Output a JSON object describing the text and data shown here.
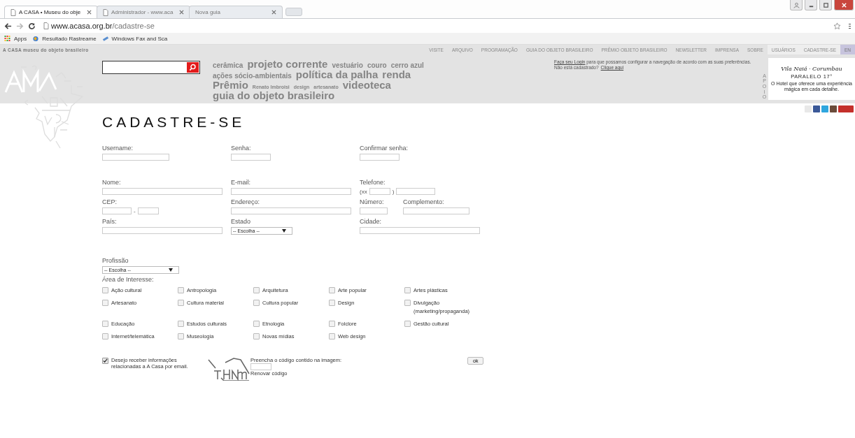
{
  "browser": {
    "tabs": [
      {
        "title": "A CASA • Museu do obje",
        "selected": true
      },
      {
        "title": "Administrador - www.aca",
        "selected": false
      },
      {
        "title": "Nova guia",
        "selected": false
      }
    ],
    "url": {
      "host": "www.acasa.org.br",
      "path": "/cadastre-se"
    },
    "bookmarks": [
      {
        "label": "Apps",
        "kind": "apps"
      },
      {
        "label": "Resultado Rastreame",
        "kind": "globe"
      },
      {
        "label": "Windows Fax and Sca",
        "kind": "fax"
      }
    ]
  },
  "site": {
    "brand": "A CASA museu do objeto brasileiro",
    "nav": [
      {
        "label": "VISITE",
        "kind": "page"
      },
      {
        "label": "ARQUIVO",
        "kind": "page"
      },
      {
        "label": "PROGRAMAÇÃO",
        "kind": "page"
      },
      {
        "label": "GUIA DO OBJETO BRASILEIRO",
        "kind": "page"
      },
      {
        "label": "PRÊMIO OBJETO BRASILEIRO",
        "kind": "page"
      },
      {
        "label": "NEWSLETTER",
        "kind": "page"
      },
      {
        "label": "IMPRENSA",
        "kind": "page"
      },
      {
        "label": "SOBRE",
        "kind": "page"
      },
      {
        "label": "USUÁRIOS",
        "kind": "user"
      },
      {
        "label": "CADASTRE-SE",
        "kind": "user"
      },
      {
        "label": "EN",
        "kind": "lang"
      }
    ],
    "tags": [
      {
        "label": "cerâmica"
      },
      {
        "label": "projeto corrente"
      },
      {
        "label": "vestuário"
      },
      {
        "label": "couro"
      },
      {
        "label": "cerro azul"
      },
      {
        "label": "ações sócio-ambientais"
      },
      {
        "label": "política da palha"
      },
      {
        "label": "renda"
      },
      {
        "label": "Prêmio"
      },
      {
        "label": "Renato Imbroisi"
      },
      {
        "label": "design"
      },
      {
        "label": "artesanato"
      },
      {
        "label": "videoteca"
      },
      {
        "label": "guia do objeto brasileiro"
      }
    ],
    "login": {
      "link": "Faça seu Login",
      "text": "para que possamos configurar a navegação de acordo com as suas preferências.",
      "question": "Não está cadastrado?",
      "signup_link": "Clique aqui"
    },
    "sponsor": {
      "label": "APOIO",
      "name": "Vila Naiá · Corumbau",
      "sub": "PARALELO 17°",
      "text": "O Hotel que oferece uma experiência mágica em cada detalhe."
    },
    "social": [
      {
        "kind": "mail"
      },
      {
        "kind": "facebook"
      },
      {
        "kind": "twitter"
      },
      {
        "kind": "instagram"
      },
      {
        "kind": "youtube"
      }
    ]
  },
  "form": {
    "title": "CADASTRE-SE",
    "rows": [
      [
        {
          "label": "Username:",
          "kind": "text"
        },
        {
          "label": "Senha:",
          "kind": "text"
        },
        {
          "label": "Confirmar senha:",
          "kind": "text"
        }
      ],
      [
        {
          "label": "Nome:",
          "kind": "text"
        },
        {
          "label": "E-mail:",
          "kind": "text"
        },
        {
          "label": "Telefone:",
          "kind": "phone",
          "prefix": "(xx",
          "suffix": ")"
        }
      ],
      [
        {
          "label": "CEP:",
          "kind": "cep",
          "separator": "-"
        },
        {
          "label": "Endereço:",
          "kind": "text"
        },
        {
          "label": "Número:",
          "kind": "text"
        },
        {
          "label": "Complemento:",
          "kind": "text"
        }
      ],
      [
        {
          "label": "País:",
          "kind": "text"
        },
        {
          "label": "Estado",
          "kind": "select",
          "value": "-- Escolha --"
        },
        {
          "label": "Cidade:",
          "kind": "text"
        }
      ]
    ],
    "profession": {
      "label": "Profissão",
      "value": "-- Escolha --"
    },
    "interests_label": "Área de Interesse:",
    "interests": [
      {
        "label": "Ação cultural",
        "checked": false
      },
      {
        "label": "Antropologia",
        "checked": false
      },
      {
        "label": "Arquitetura",
        "checked": false
      },
      {
        "label": "Arte popular",
        "checked": false
      },
      {
        "label": "Artes plásticas",
        "checked": false
      },
      {
        "label": "Artesanato",
        "checked": false
      },
      {
        "label": "Cultura material",
        "checked": false
      },
      {
        "label": "Cultura popular",
        "checked": false
      },
      {
        "label": "Design",
        "checked": false
      },
      {
        "label": "Divulgação (marketing/propaganda)",
        "checked": false
      },
      {
        "label": "Educação",
        "checked": false
      },
      {
        "label": "Estudos culturais",
        "checked": false
      },
      {
        "label": "Etnologia",
        "checked": false
      },
      {
        "label": "Folclore",
        "checked": false
      },
      {
        "label": "Gestão cultural",
        "checked": false
      },
      {
        "label": "Internet/telemática",
        "checked": false
      },
      {
        "label": "Museologia",
        "checked": false
      },
      {
        "label": "Novas mídias",
        "checked": false
      },
      {
        "label": "Web design",
        "checked": false
      }
    ],
    "newsletter": {
      "label": "Desejo receber informações relacionadas a A Casa por email.",
      "checked": true
    },
    "captcha": {
      "prompt": "Preencha o código contido na imagem:",
      "renew": "Renovar código"
    },
    "submit": "ok"
  }
}
